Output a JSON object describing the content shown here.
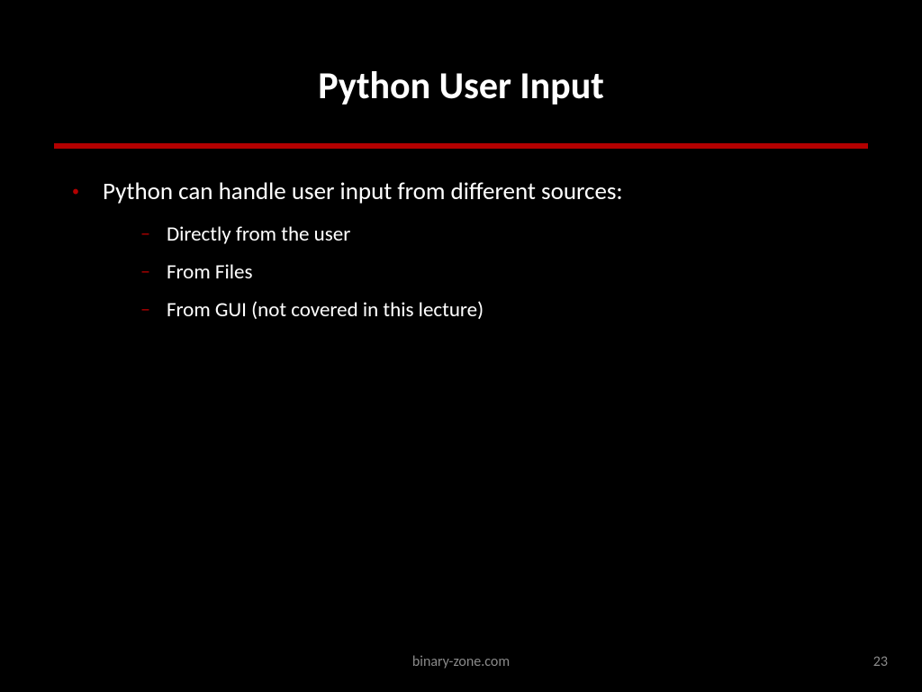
{
  "title": "Python User Input",
  "content": {
    "main_bullet": "Python can handle user input from different sources:",
    "sub_bullets": [
      "Directly from the user",
      "From Files",
      "From GUI (not covered in this lecture)"
    ]
  },
  "footer": {
    "website": "binary-zone.com",
    "page_number": "23"
  },
  "colors": {
    "accent": "#b30000",
    "background": "#000000",
    "text": "#ffffff",
    "muted": "#8a8a8a"
  }
}
